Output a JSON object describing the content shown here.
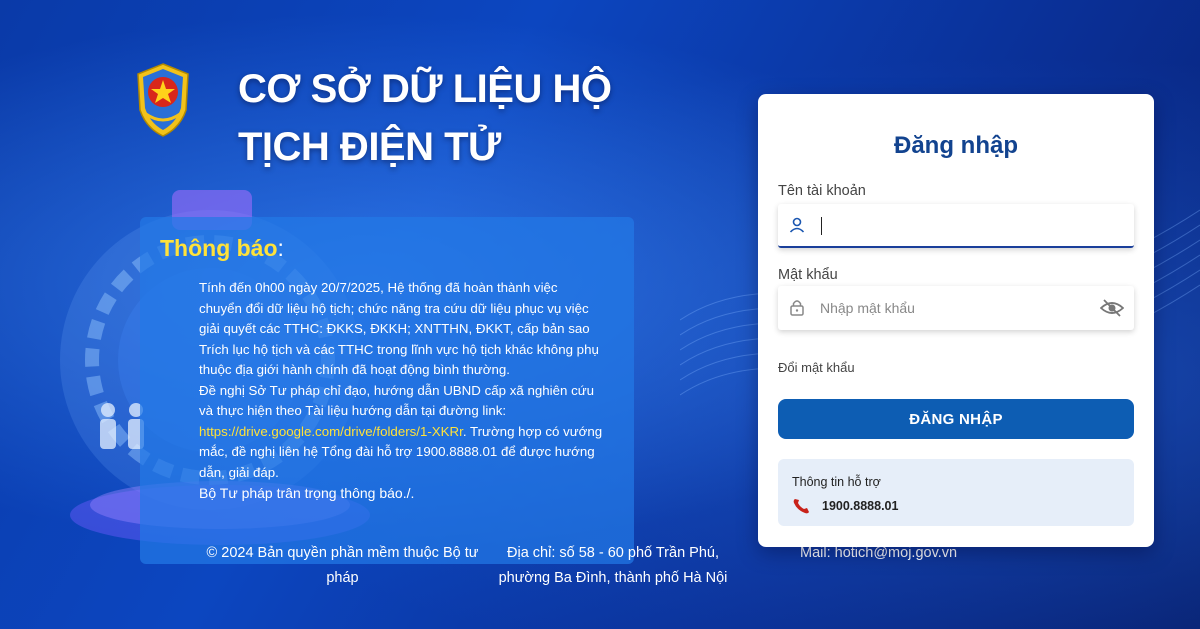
{
  "header": {
    "title_line1": "CƠ SỞ DỮ LIỆU HỘ",
    "title_line2": "TỊCH ĐIỆN TỬ"
  },
  "notice": {
    "title": "Thông báo",
    "colon": ":",
    "paragraph1": "Tính đến 0h00 ngày 20/7/2025, Hệ thống đã hoàn thành việc chuyển đổi dữ liệu hộ tịch; chức năng tra cứu dữ liệu phục vụ việc giải quyết các TTHC: ĐKKS, ĐKKH; XNTTHN, ĐKKT, cấp bản sao Trích lục hộ tịch và các TTHC trong lĩnh vực hộ tịch khác không phụ thuộc địa giới hành chính đã hoạt động bình thường.",
    "paragraph2_a": "Đề nghị Sở Tư pháp chỉ đạo, hướng dẫn UBND cấp xã nghiên cứu và thực hiện theo Tài liệu hướng dẫn tại đường link:",
    "link": "https://drive.google.com/drive/folders/1-XKRr",
    "paragraph2_b": ". Trường hợp có vướng mắc, đề nghị liên hệ Tổng đài hỗ trợ 1900.8888.01 để được hướng dẫn, giải đáp.",
    "sign": "Bộ Tư pháp trân trọng thông báo./."
  },
  "footer": {
    "copyright": "© 2024 Bản quyền phần mềm thuộc Bộ tư pháp",
    "address": "Địa chỉ: số 58 - 60 phố Trần Phú, phường Ba Đình, thành phố Hà Nội",
    "mail": "Mail: hotich@moj.gov.vn"
  },
  "login": {
    "title": "Đăng nhập",
    "username_label": "Tên tài khoản",
    "username_value": "",
    "password_label": "Mật khẩu",
    "password_placeholder": "Nhập mật khẩu",
    "forgot": "Đổi mật khẩu",
    "submit": "ĐĂNG NHẬP"
  },
  "support": {
    "title": "Thông tin hỗ trợ",
    "phone": "1900.8888.01"
  },
  "colors": {
    "primary": "#0d5db3",
    "title_blue": "#12438f",
    "notice_yellow": "#ffe23a"
  }
}
